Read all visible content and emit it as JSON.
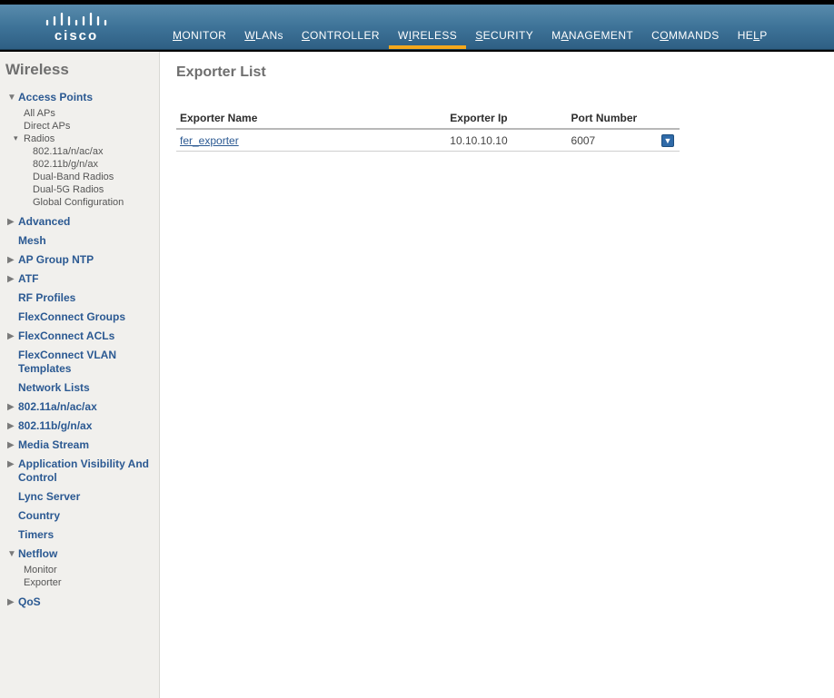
{
  "brand": "cisco",
  "nav": [
    {
      "label": "MONITOR"
    },
    {
      "label": "WLANs"
    },
    {
      "label": "CONTROLLER"
    },
    {
      "label": "WIRELESS"
    },
    {
      "label": "SECURITY"
    },
    {
      "label": "MANAGEMENT"
    },
    {
      "label": "COMMANDS"
    },
    {
      "label": "HELP"
    }
  ],
  "sidebar": {
    "title": "Wireless",
    "access_points": {
      "label": "Access Points",
      "items": {
        "all": "All APs",
        "direct": "Direct APs",
        "radios": "Radios",
        "radio_list": [
          "802.11a/n/ac/ax",
          "802.11b/g/n/ax",
          "Dual-Band Radios",
          "Dual-5G Radios",
          "Global Configuration"
        ]
      }
    },
    "advanced": "Advanced",
    "mesh": "Mesh",
    "ap_group_ntp": "AP Group NTP",
    "atf": "ATF",
    "rf_profiles": "RF Profiles",
    "flexconnect_groups": "FlexConnect Groups",
    "flexconnect_acls": "FlexConnect ACLs",
    "flexconnect_vlan": "FlexConnect VLAN Templates",
    "network_lists": "Network Lists",
    "band_a": "802.11a/n/ac/ax",
    "band_b": "802.11b/g/n/ax",
    "media_stream": "Media Stream",
    "avc": "Application Visibility And Control",
    "lync": "Lync Server",
    "country": "Country",
    "timers": "Timers",
    "netflow": {
      "label": "Netflow",
      "monitor": "Monitor",
      "exporter": "Exporter"
    },
    "qos": "QoS"
  },
  "page": {
    "title": "Exporter List",
    "columns": {
      "name": "Exporter Name",
      "ip": "Exporter Ip",
      "port": "Port Number"
    },
    "rows": [
      {
        "name": "fer_exporter",
        "ip": "10.10.10.10",
        "port": "6007"
      }
    ]
  }
}
